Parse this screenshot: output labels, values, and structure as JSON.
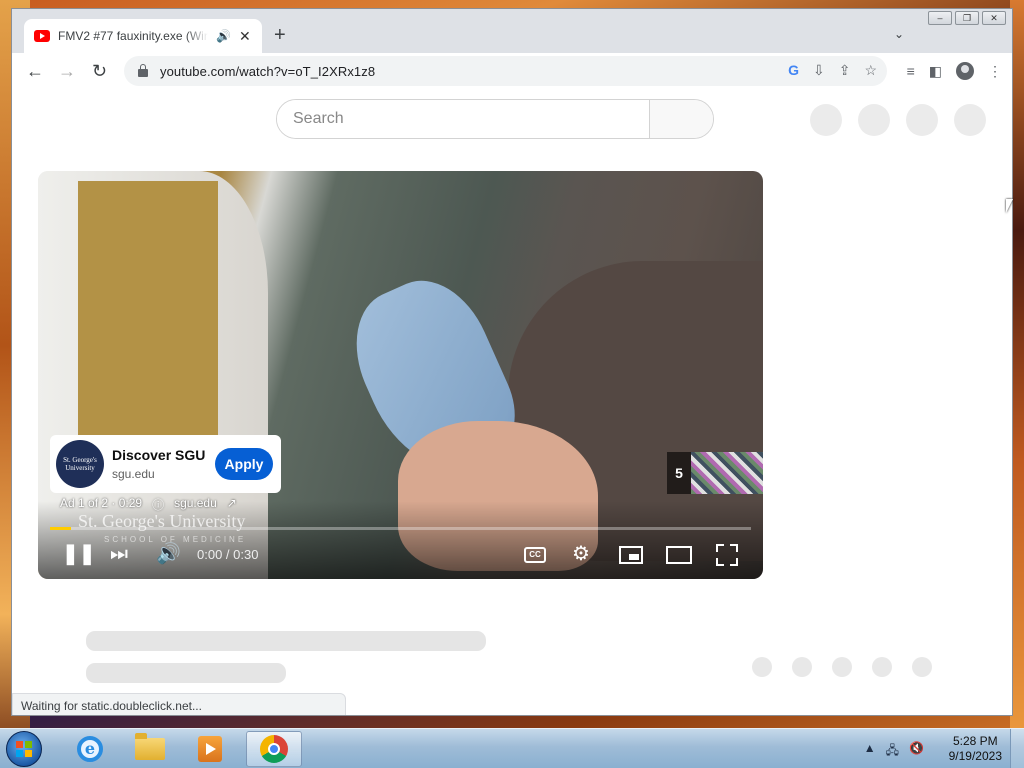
{
  "browser": {
    "tab_title": "FMV2 #77 fauxinity.exe (Wir",
    "tab_audio_icon": "speaker-icon",
    "url": "youtube.com/watch?v=oT_I2XRx1z8",
    "status_text": "Waiting for static.doubleclick.net..."
  },
  "window_controls": {
    "minimize": "–",
    "restore": "❐",
    "close": "✕"
  },
  "youtube": {
    "search_placeholder": "Search"
  },
  "ad": {
    "logo_text": "St. George's University",
    "title": "Discover SGU",
    "domain": "sgu.edu",
    "cta": "Apply",
    "info_position": "Ad 1 of 2 · 0:29",
    "info_domain": "sgu.edu",
    "skip_count": "5",
    "watermark": "St. George's University",
    "watermark_sub": "SCHOOL OF MEDICINE"
  },
  "player": {
    "time": "0:00 / 0:30",
    "progress_fraction": 0.03,
    "progress_color": "#ffcc00",
    "cc_label": "CC"
  },
  "taskbar": {
    "time": "5:28 PM",
    "date": "9/19/2023"
  }
}
